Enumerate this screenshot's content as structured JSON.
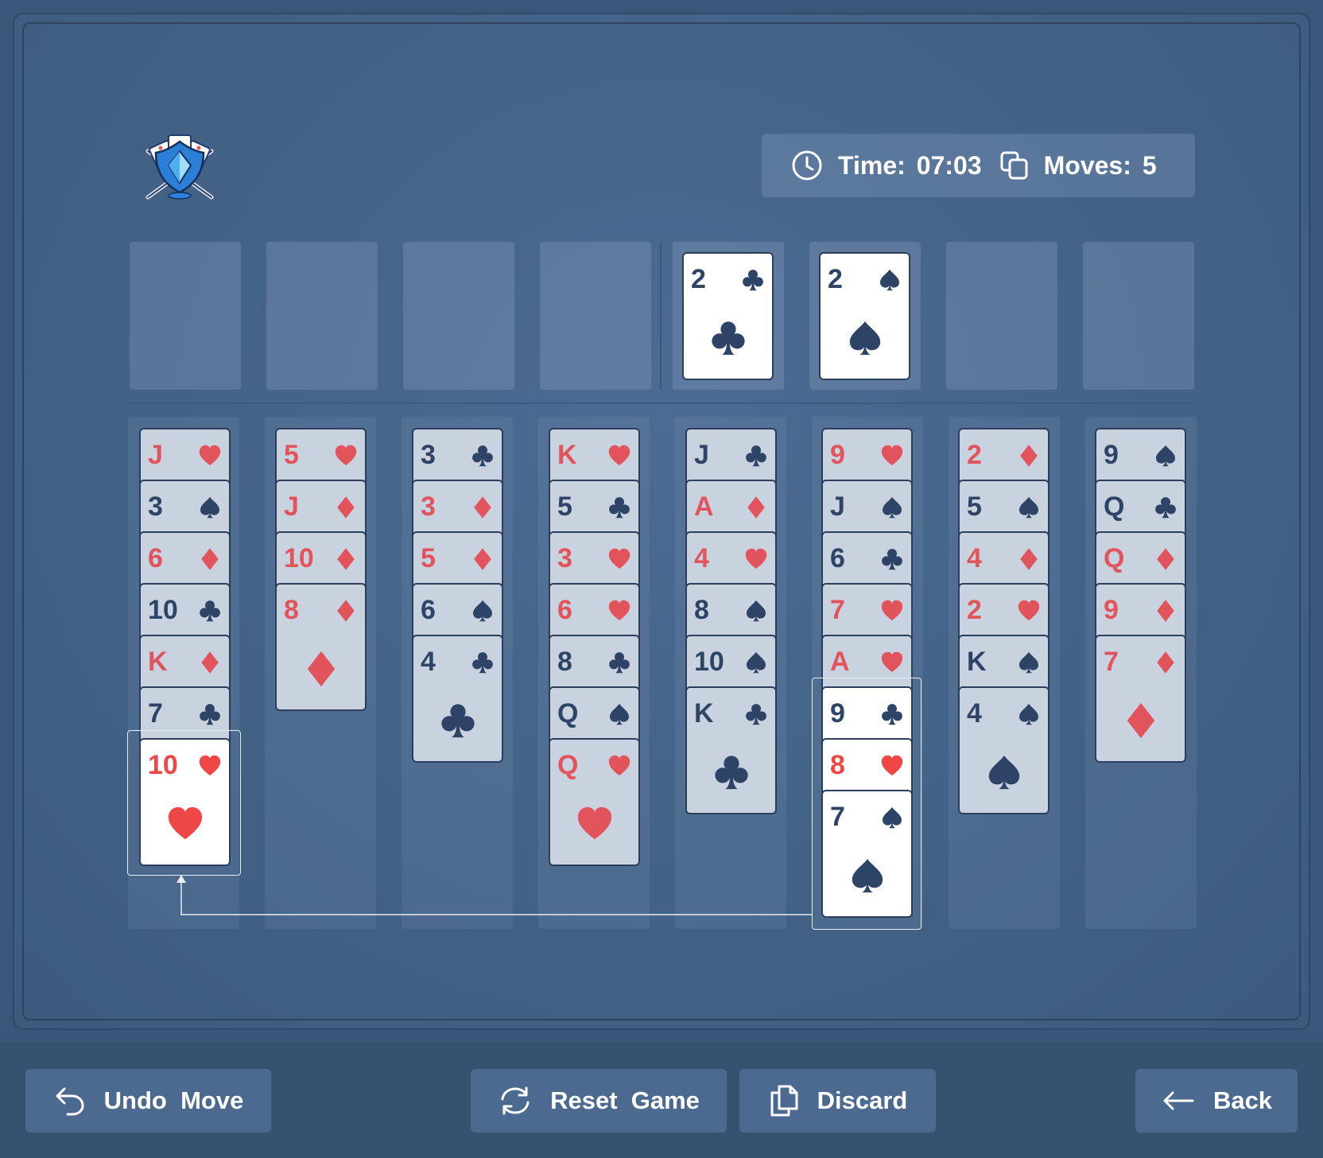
{
  "header": {
    "time_label": "Time:",
    "time_value": "07:03",
    "moves_label": "Moves:",
    "moves_value": "5"
  },
  "icons": {
    "logo": "card-shield-swords-logo",
    "time": "clock-icon",
    "moves": "copy-icon",
    "undo": "undo-arrow-icon",
    "reset": "refresh-icon",
    "discard": "documents-icon",
    "back": "arrow-left-icon"
  },
  "colors": {
    "background": "#3b5679",
    "board": "#456489",
    "red_suit": "#e2545c",
    "black_suit": "#2d4466",
    "card_face": "#c9d2df",
    "card_active": "#ffffff"
  },
  "top_row": [
    {
      "type": "freecell",
      "card": null
    },
    {
      "type": "freecell",
      "card": null
    },
    {
      "type": "freecell",
      "card": null
    },
    {
      "type": "freecell",
      "card": null
    },
    {
      "type": "foundation",
      "card": {
        "rank": "2",
        "suit": "clubs"
      }
    },
    {
      "type": "foundation",
      "card": {
        "rank": "2",
        "suit": "spades"
      }
    },
    {
      "type": "foundation",
      "card": null
    },
    {
      "type": "foundation",
      "card": null
    }
  ],
  "tableau": [
    [
      {
        "rank": "J",
        "suit": "hearts"
      },
      {
        "rank": "3",
        "suit": "spades"
      },
      {
        "rank": "6",
        "suit": "diamonds"
      },
      {
        "rank": "10",
        "suit": "clubs"
      },
      {
        "rank": "K",
        "suit": "diamonds"
      },
      {
        "rank": "7",
        "suit": "clubs"
      },
      {
        "rank": "10",
        "suit": "hearts",
        "active": true
      }
    ],
    [
      {
        "rank": "5",
        "suit": "hearts"
      },
      {
        "rank": "J",
        "suit": "diamonds"
      },
      {
        "rank": "10",
        "suit": "diamonds"
      },
      {
        "rank": "8",
        "suit": "diamonds"
      }
    ],
    [
      {
        "rank": "3",
        "suit": "clubs"
      },
      {
        "rank": "3",
        "suit": "diamonds"
      },
      {
        "rank": "5",
        "suit": "diamonds"
      },
      {
        "rank": "6",
        "suit": "spades"
      },
      {
        "rank": "4",
        "suit": "clubs"
      }
    ],
    [
      {
        "rank": "K",
        "suit": "hearts"
      },
      {
        "rank": "5",
        "suit": "clubs"
      },
      {
        "rank": "3",
        "suit": "hearts"
      },
      {
        "rank": "6",
        "suit": "hearts"
      },
      {
        "rank": "8",
        "suit": "clubs"
      },
      {
        "rank": "Q",
        "suit": "spades"
      },
      {
        "rank": "Q",
        "suit": "hearts"
      }
    ],
    [
      {
        "rank": "J",
        "suit": "clubs"
      },
      {
        "rank": "A",
        "suit": "diamonds"
      },
      {
        "rank": "4",
        "suit": "hearts"
      },
      {
        "rank": "8",
        "suit": "spades"
      },
      {
        "rank": "10",
        "suit": "spades"
      },
      {
        "rank": "K",
        "suit": "clubs"
      }
    ],
    [
      {
        "rank": "9",
        "suit": "hearts"
      },
      {
        "rank": "J",
        "suit": "spades"
      },
      {
        "rank": "6",
        "suit": "clubs"
      },
      {
        "rank": "7",
        "suit": "hearts"
      },
      {
        "rank": "A",
        "suit": "hearts"
      },
      {
        "rank": "9",
        "suit": "clubs",
        "active": true
      },
      {
        "rank": "8",
        "suit": "hearts",
        "active": true
      },
      {
        "rank": "7",
        "suit": "spades",
        "active": true
      }
    ],
    [
      {
        "rank": "2",
        "suit": "diamonds"
      },
      {
        "rank": "5",
        "suit": "spades"
      },
      {
        "rank": "4",
        "suit": "diamonds"
      },
      {
        "rank": "2",
        "suit": "hearts"
      },
      {
        "rank": "K",
        "suit": "spades"
      },
      {
        "rank": "4",
        "suit": "spades"
      }
    ],
    [
      {
        "rank": "9",
        "suit": "spades"
      },
      {
        "rank": "Q",
        "suit": "clubs"
      },
      {
        "rank": "Q",
        "suit": "diamonds"
      },
      {
        "rank": "9",
        "suit": "diamonds"
      },
      {
        "rank": "7",
        "suit": "diamonds"
      }
    ]
  ],
  "buttons": {
    "undo": "Undo  Move",
    "reset": "Reset  Game",
    "discard": "Discard",
    "back": "Back"
  }
}
